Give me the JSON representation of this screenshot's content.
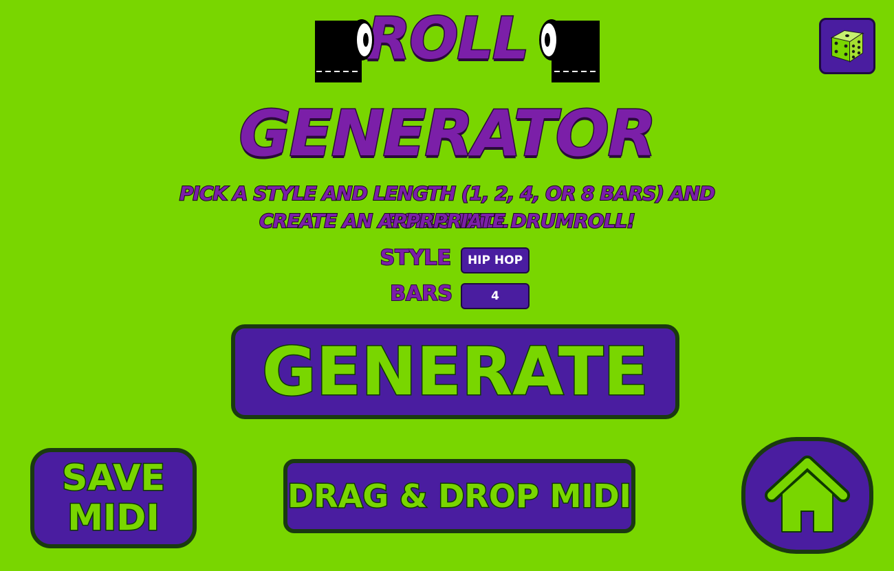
{
  "title": {
    "line1": "ROLL",
    "line2": "GENERATOR"
  },
  "description": {
    "line1": "PICK A STYLE AND LENGTH (1, 2, 4, OR 8 BARS) AND ROLLS WILL",
    "line2": "CREATE AN APPRPRIATE DRUMROLL!"
  },
  "settings": {
    "style_label": "STYLE",
    "style_value": "HIP HOP",
    "bars_label": "BARS",
    "bars_value": "4"
  },
  "buttons": {
    "generate": "GENERATE",
    "save_line1": "SAVE",
    "save_line2": "MIDI",
    "drag_drop": "DRAG & DROP MIDI"
  },
  "icons": {
    "dice": "dice-icon",
    "home": "home-icon",
    "roll": "toilet-roll-icon"
  },
  "colors": {
    "background": "#79d600",
    "purple": "#4a1da0",
    "title_purple": "#7b1fa8",
    "green_text": "#79d600"
  }
}
